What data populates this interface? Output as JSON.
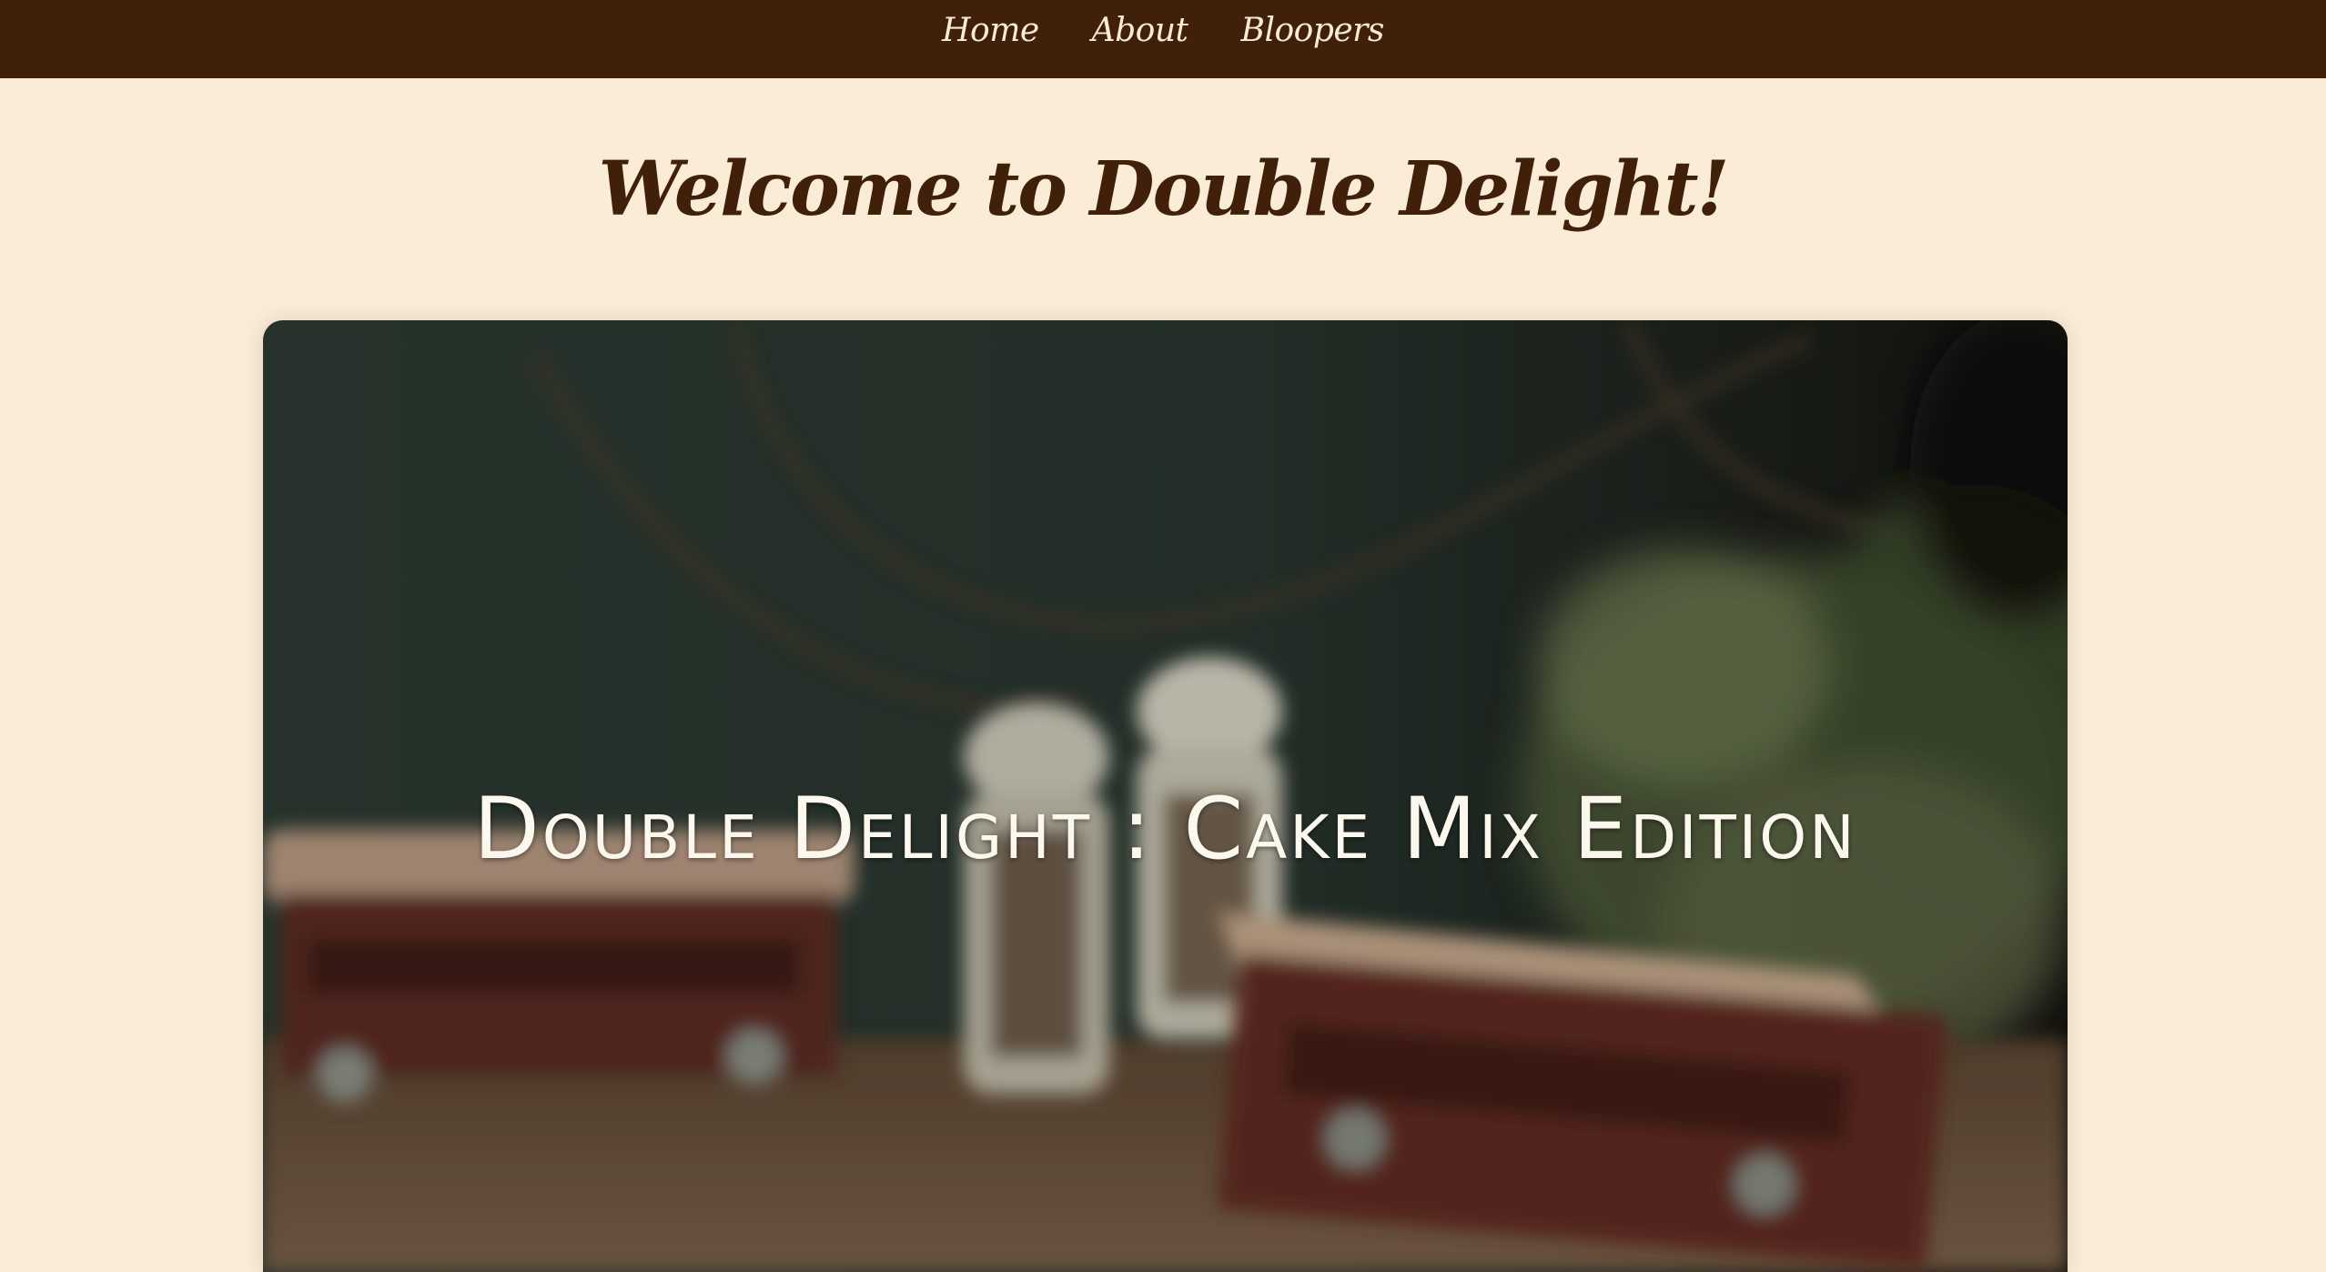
{
  "nav": {
    "items": [
      {
        "label": "Home"
      },
      {
        "label": "About"
      },
      {
        "label": "Bloopers"
      }
    ]
  },
  "page": {
    "title": "Welcome to Double Delight!"
  },
  "hero": {
    "title": "Double Delight : Cake Mix Edition"
  },
  "colors": {
    "navbar_bg": "#41200a",
    "page_bg": "#fbecd7",
    "title_text": "#41200a",
    "nav_text": "#fbecd7",
    "hero_text": "#fdf8ee"
  }
}
